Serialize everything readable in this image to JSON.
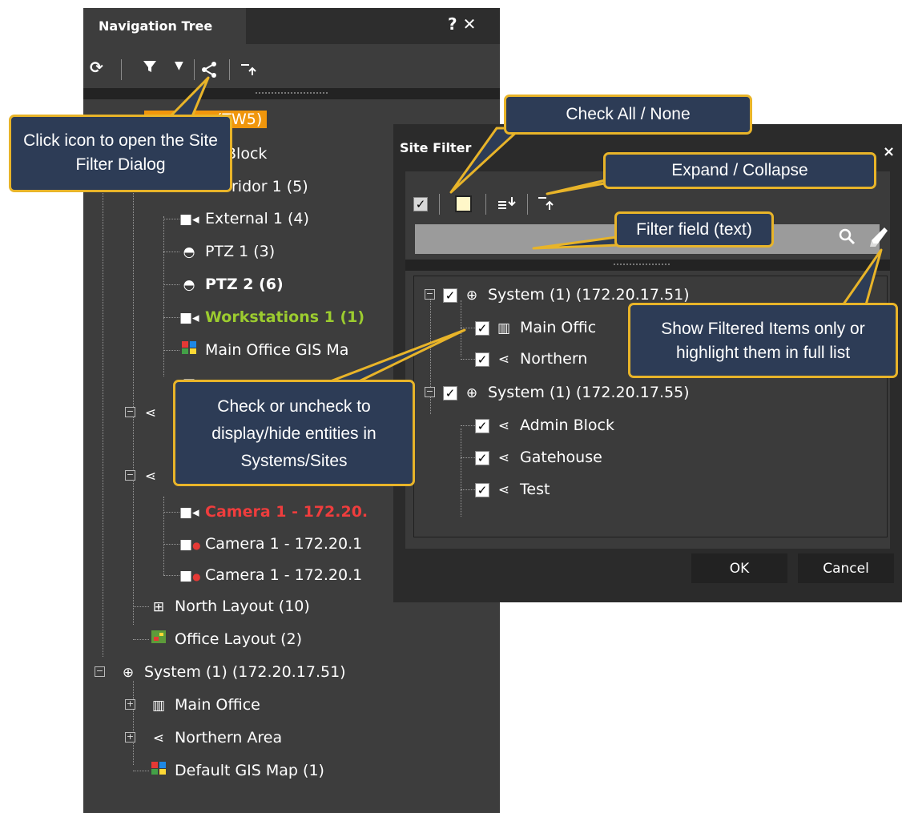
{
  "nav": {
    "title": "Navigation Tree",
    "title_buttons": "? ✕",
    "toolbar": {
      "refresh_icon": "refresh-icon",
      "filter_icon": "funnel-icon",
      "dropdown_icon": "caret-down-icon",
      "site_filter_icon": "site-tree-icon",
      "collapse_icon": "collapse-up-icon"
    },
    "rows": [
      {
        "label": "(TW5)",
        "icon": "system-icon"
      },
      {
        "label": "Block",
        "icon": "site-icon"
      },
      {
        "label": "ridor 1 (5)",
        "icon": "site-icon"
      },
      {
        "label": "External 1 (4)",
        "icon": "camera-icon"
      },
      {
        "label": "PTZ 1 (3)",
        "icon": "ptz-icon"
      },
      {
        "label": "PTZ 2 (6)",
        "icon": "ptz-icon"
      },
      {
        "label": "Workstations 1 (1)",
        "icon": "camera-icon"
      },
      {
        "label": "Main Office GIS Ma",
        "icon": "gis-map-icon"
      },
      {
        "label": "Camera 1 - 172.20.",
        "icon": "camera-icon"
      },
      {
        "label": "Camera 1 - 172.20.1",
        "icon": "camera-error-icon"
      },
      {
        "label": "Camera 1 - 172.20.1",
        "icon": "camera-error-icon"
      },
      {
        "label": "North Layout (10)",
        "icon": "layout-icon"
      },
      {
        "label": "Office Layout (2)",
        "icon": "map-layout-icon"
      },
      {
        "label": "System (1) (172.20.17.51)",
        "icon": "system-icon"
      },
      {
        "label": "Main Office",
        "icon": "building-icon"
      },
      {
        "label": "Northern Area",
        "icon": "site-icon"
      },
      {
        "label": "Default GIS Map (1)",
        "icon": "gis-map-icon"
      }
    ],
    "selected_color": "#f0960c",
    "highlight_green": "#9ccc2f",
    "error_red": "#ef3d3d"
  },
  "dialog": {
    "title": "Site Filter",
    "close_glyph": "×",
    "toolbar": {
      "check_all_icon": "check-all-icon",
      "check_none_icon": "check-none-icon",
      "expand_icon": "expand-down-icon",
      "collapse_icon": "collapse-up-icon"
    },
    "filter_placeholder": "",
    "search_icon": "search-icon",
    "eraser_icon": "eraser-icon",
    "tree": [
      {
        "label": "System (1) (172.20.17.51)",
        "checked": true,
        "icon": "system-icon"
      },
      {
        "label": "Main Offic",
        "checked": true,
        "icon": "building-icon"
      },
      {
        "label": "Northern",
        "checked": true,
        "icon": "site-icon"
      },
      {
        "label": "System (1) (172.20.17.55)",
        "checked": true,
        "icon": "system-icon"
      },
      {
        "label": "Admin Block",
        "checked": true,
        "icon": "site-icon"
      },
      {
        "label": "Gatehouse",
        "checked": true,
        "icon": "site-icon"
      },
      {
        "label": "Test",
        "checked": true,
        "icon": "site-icon"
      }
    ],
    "ok_label": "OK",
    "cancel_label": "Cancel"
  },
  "callouts": {
    "site_filter": "Click icon to open the Site Filter Dialog",
    "check_all": "Check All / None",
    "expand": "Expand / Collapse",
    "filter_field": "Filter field (text)",
    "show_filtered": "Show Filtered Items only or highlight them in full list",
    "check_entities": "Check or uncheck to display/hide entities in Systems/Sites"
  }
}
